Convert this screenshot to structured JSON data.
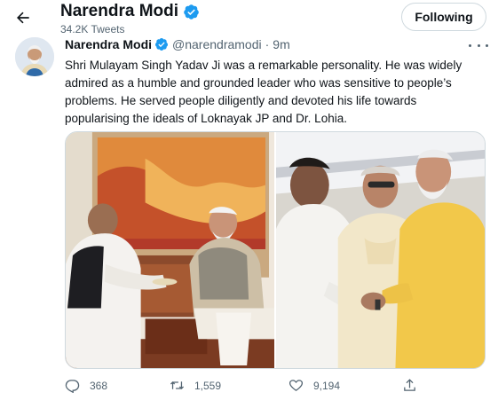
{
  "header": {
    "name": "Narendra Modi",
    "tweet_count": "34.2K Tweets",
    "following_label": "Following"
  },
  "tweet": {
    "author_name": "Narendra Modi",
    "handle": "@narendramodi",
    "separator": "·",
    "time": "9m",
    "text": "Shri Mulayam Singh Yadav Ji was a remarkable personality. He was widely admired as a humble and grounded leader who was sensitive to people’s problems. He served people diligently and devoted his life towards popularising the ideals of Loknayak JP and Dr. Lohia."
  },
  "actions": {
    "replies": "368",
    "retweets": "1,559",
    "likes": "9,194"
  },
  "icons": {
    "back": "arrow-left-icon",
    "verified": "verified-badge-icon",
    "more": "more-horizontal-icon",
    "reply": "reply-icon",
    "retweet": "retweet-icon",
    "like": "heart-icon",
    "share": "share-icon"
  },
  "colors": {
    "verified": "#1d9bf0",
    "text_primary": "#0f1419",
    "text_secondary": "#536471",
    "border": "#cfd9de"
  }
}
